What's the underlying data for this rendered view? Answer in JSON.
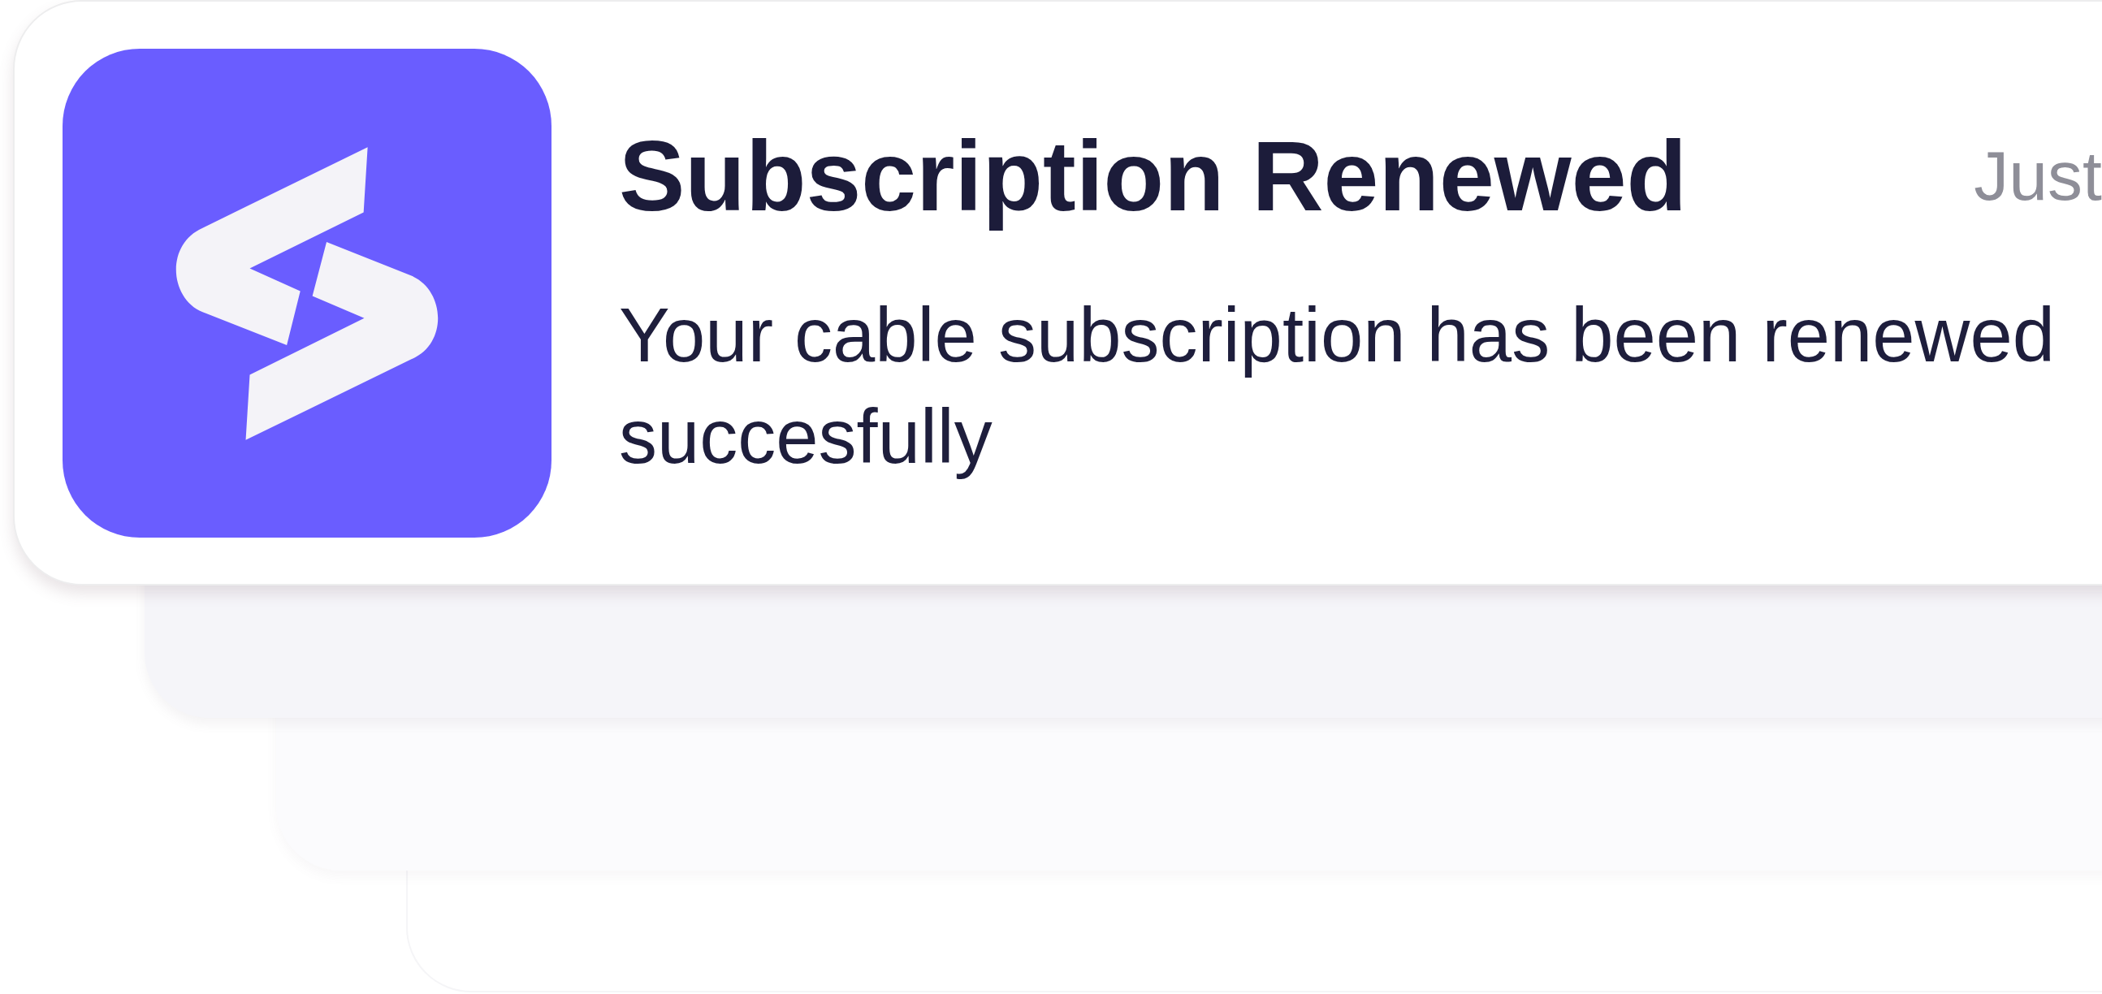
{
  "notification": {
    "title": "Subscription Renewed",
    "time": "Just",
    "message": "Your cable subscription has been renewed succesfully"
  }
}
